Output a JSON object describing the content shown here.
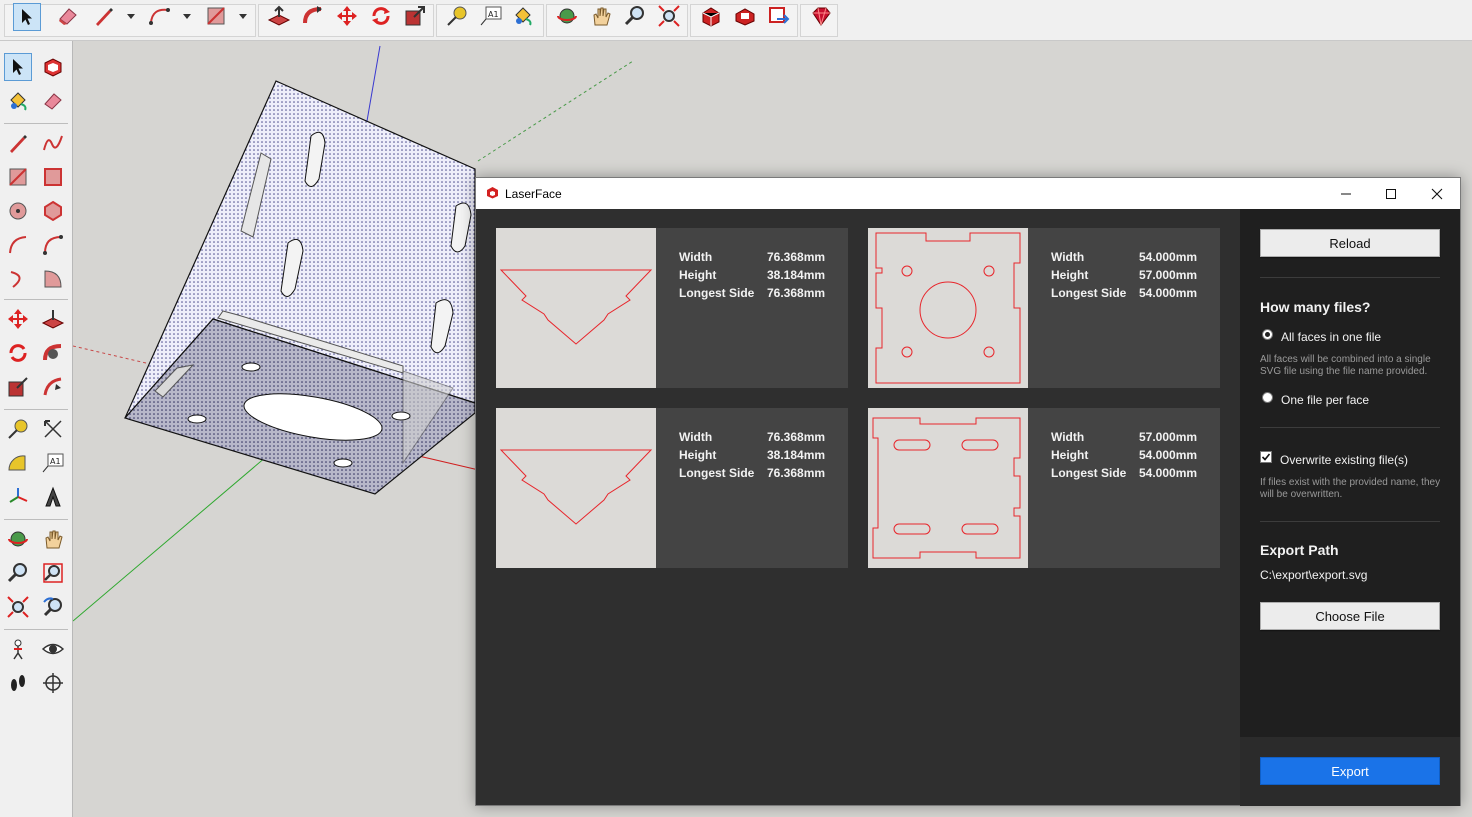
{
  "colors": {
    "accent": "#1a73e8",
    "cut_line": "#e8252b",
    "dialog_bg": "#2f2f2f",
    "sidebar_bg": "#1f1f1f",
    "card_bg": "#444444",
    "thumb_bg": "#dcdad7"
  },
  "top_toolbar": {
    "tools": [
      "select-icon",
      "eraser-icon",
      "pencil-icon",
      "arc-icon",
      "rectangle-icon",
      "push-pull-icon",
      "follow-me-icon",
      "move-icon",
      "rotate-icon",
      "scale-icon",
      "tape-measure-icon",
      "text-icon",
      "paint-bucket-icon",
      "orbit-icon",
      "pan-icon",
      "zoom-icon",
      "zoom-extents-icon",
      "warehouse-icon",
      "extension-warehouse-icon",
      "send-to-layout-icon",
      "ruby-icon"
    ]
  },
  "left_toolbar": {
    "tools": [
      "select-icon",
      "make-component-icon",
      "paint-bucket-icon",
      "eraser-icon",
      "line-icon",
      "freehand-icon",
      "rectangle-icon",
      "rotated-rectangle-icon",
      "circle-icon",
      "polygon-icon",
      "arc-icon",
      "pie-icon",
      "two-point-arc-icon",
      "three-point-arc-icon",
      "move-icon",
      "push-pull-icon",
      "rotate-icon",
      "follow-me-icon",
      "scale-icon",
      "offset-icon",
      "tape-measure-icon",
      "dimension-icon",
      "protractor-icon",
      "text-icon",
      "axes-icon",
      "3d-text-icon",
      "orbit-icon",
      "pan-icon",
      "zoom-icon",
      "zoom-window-icon",
      "zoom-extents-icon",
      "previous-view-icon",
      "position-camera-icon",
      "look-around-icon",
      "walk-icon",
      "section-plane-icon"
    ]
  },
  "dialog": {
    "title": "LaserFace",
    "faces": [
      {
        "width_label": "Width",
        "width": "76.368mm",
        "height_label": "Height",
        "height": "38.184mm",
        "longest_label": "Longest Side",
        "longest": "76.368mm"
      },
      {
        "width_label": "Width",
        "width": "54.000mm",
        "height_label": "Height",
        "height": "57.000mm",
        "longest_label": "Longest Side",
        "longest": "54.000mm"
      },
      {
        "width_label": "Width",
        "width": "76.368mm",
        "height_label": "Height",
        "height": "38.184mm",
        "longest_label": "Longest Side",
        "longest": "76.368mm"
      },
      {
        "width_label": "Width",
        "width": "57.000mm",
        "height_label": "Height",
        "height": "54.000mm",
        "longest_label": "Longest Side",
        "longest": "54.000mm"
      }
    ],
    "sidebar": {
      "reload_label": "Reload",
      "files_heading": "How many files?",
      "option_single": "All faces in one file",
      "option_single_help": "All faces will be combined into a single SVG file using the file name provided.",
      "option_single_selected": true,
      "option_multi": "One file per face",
      "overwrite_label": "Overwrite existing file(s)",
      "overwrite_checked": true,
      "overwrite_help": "If files exist with the provided name, they will be overwritten.",
      "export_heading": "Export Path",
      "export_path": "C:\\export\\export.svg",
      "choose_file_label": "Choose File",
      "export_label": "Export"
    }
  }
}
